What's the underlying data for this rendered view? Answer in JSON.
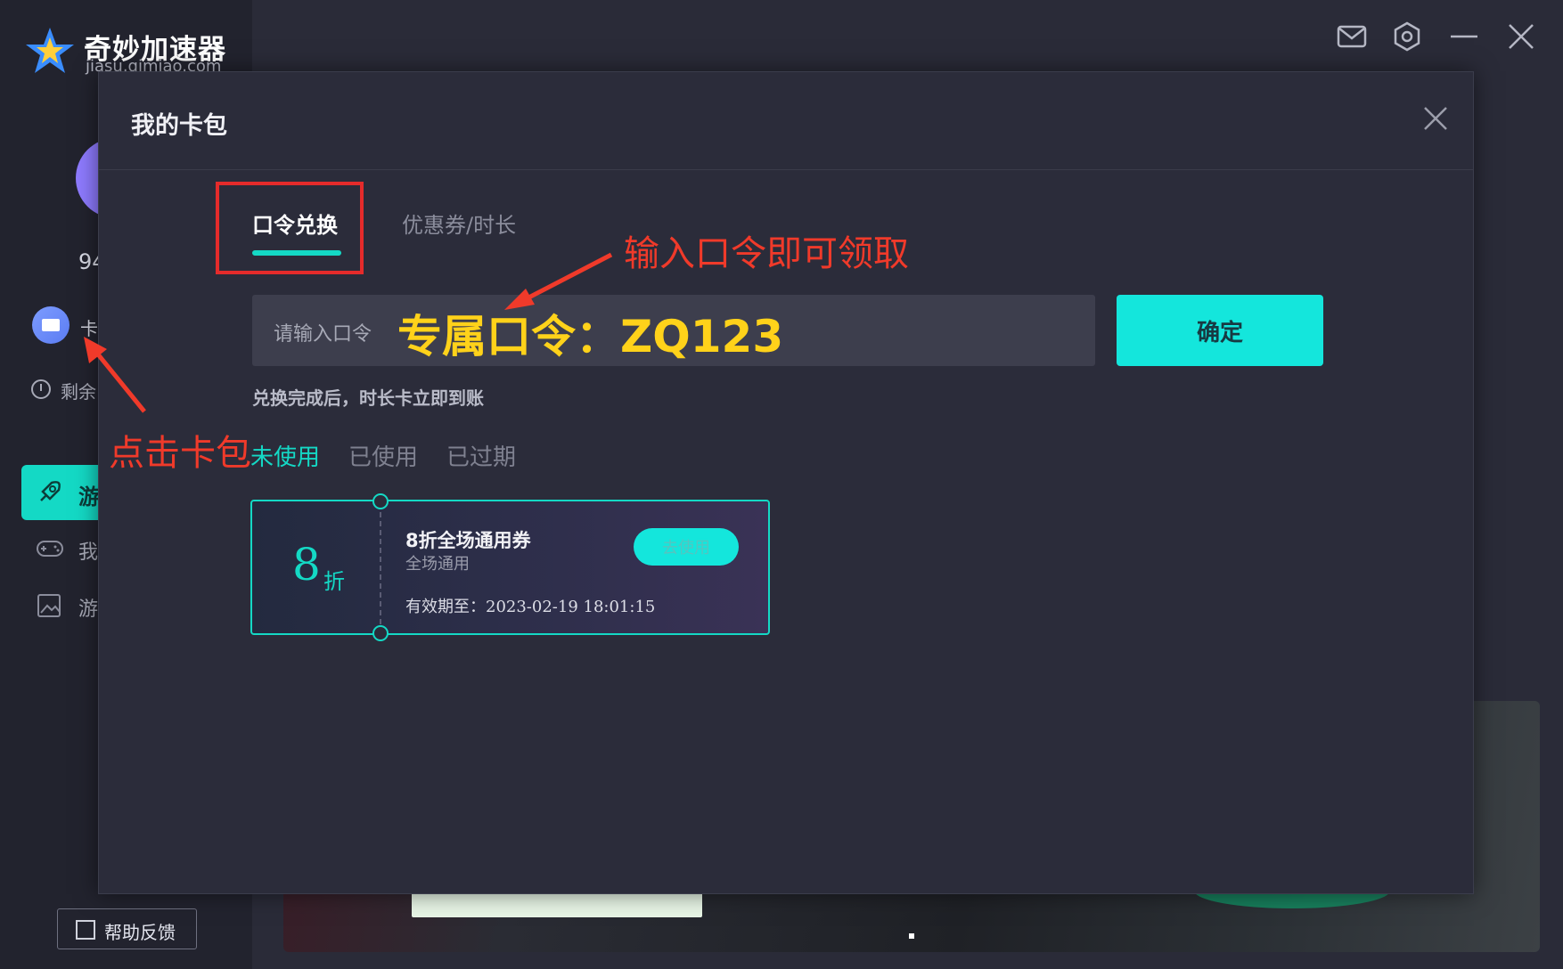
{
  "app": {
    "name": "奇妙加速器",
    "domain": "jiasu.qimiao.com"
  },
  "sidebar": {
    "user_number": "94",
    "card_label": "卡",
    "remaining_label": "剩余",
    "nav": [
      {
        "label": "游",
        "icon": "rocket-icon",
        "active": true
      },
      {
        "label": "我",
        "icon": "gamepad-icon",
        "active": false
      },
      {
        "label": "游",
        "icon": "image-icon",
        "active": false
      }
    ],
    "help_button": "帮助反馈"
  },
  "titlebar": {
    "icons": [
      "mail-icon",
      "settings-icon",
      "minimize-icon",
      "close-icon"
    ]
  },
  "modal": {
    "title": "我的卡包",
    "tabs": [
      {
        "label": "口令兑换",
        "active": true
      },
      {
        "label": "优惠券/时长",
        "active": false
      }
    ],
    "input": {
      "placeholder": "请输入口令",
      "value": ""
    },
    "confirm_button": "确定",
    "hint": "兑换完成后，时长卡立即到账",
    "filters": [
      {
        "label": "未使用",
        "active": true
      },
      {
        "label": "已使用",
        "active": false
      },
      {
        "label": "已过期",
        "active": false
      }
    ],
    "coupon": {
      "discount": "8",
      "discount_unit": "折",
      "title": "8折全场通用券",
      "subtitle": "全场通用",
      "expiry": "有效期至：2023-02-19 18:01:15",
      "use_button": "去使用"
    }
  },
  "annotations": {
    "code_overlay": "专属口令：ZQ123",
    "input_hint": "输入口令即可领取",
    "card_hint": "点击卡包",
    "color": "#f03a2a"
  },
  "colors": {
    "accent": "#14d9c5",
    "button": "#14e6dc",
    "highlight": "#ffd21a",
    "annotation_red": "#e52b2b"
  }
}
